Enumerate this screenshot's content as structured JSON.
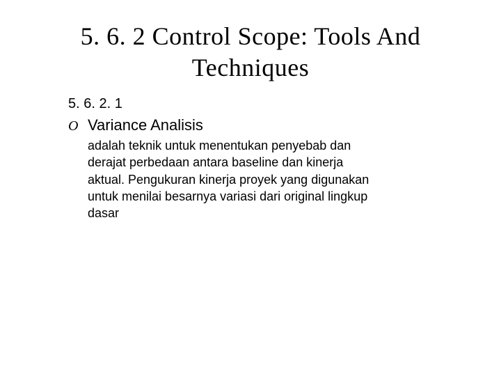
{
  "title": "5. 6. 2 Control Scope: Tools And Techniques",
  "section_number": "5. 6. 2. 1",
  "bullet_marker": "O",
  "item_title": "Variance Analisis",
  "description": "adalah teknik untuk menentukan penyebab dan derajat perbedaan antara baseline dan kinerja aktual. Pengukuran kinerja proyek yang digunakan untuk menilai besarnya variasi dari original lingkup dasar"
}
